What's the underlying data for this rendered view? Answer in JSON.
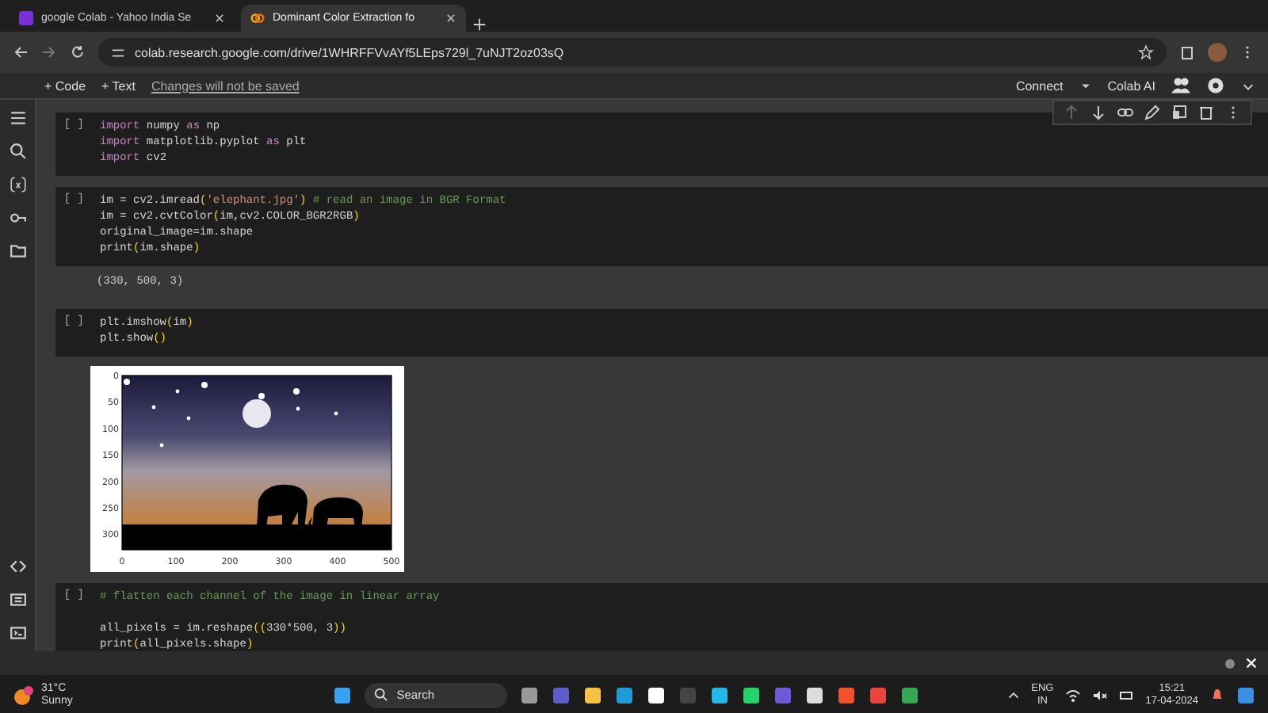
{
  "browser": {
    "tabs": [
      {
        "title": "google Colab - Yahoo India Se",
        "selected": false
      },
      {
        "title": "Dominant Color Extraction fo",
        "selected": true
      }
    ],
    "url": "colab.research.google.com/drive/1WHRFFVvAYf5LEps729l_7uNJT2oz03sQ"
  },
  "toolbar": {
    "add_code": "+ Code",
    "add_text": "+ Text",
    "notice": "Changes will not be saved",
    "connect": "Connect",
    "colab_ai": "Colab AI"
  },
  "cells": [
    {
      "run": "[ ]",
      "lines": [
        [
          {
            "kind": "kw",
            "text": "import"
          },
          {
            "kind": "plain",
            "text": " numpy "
          },
          {
            "kind": "kw",
            "text": "as"
          },
          {
            "kind": "plain",
            "text": " np"
          }
        ],
        [
          {
            "kind": "kw",
            "text": "import"
          },
          {
            "kind": "plain",
            "text": " matplotlib.pyplot "
          },
          {
            "kind": "kw",
            "text": "as"
          },
          {
            "kind": "plain",
            "text": " plt"
          }
        ],
        [
          {
            "kind": "kw",
            "text": "import"
          },
          {
            "kind": "plain",
            "text": " cv2"
          }
        ]
      ]
    },
    {
      "run": "[ ]",
      "lines": [
        [
          {
            "kind": "plain",
            "text": "im = cv2.imread"
          },
          {
            "kind": "br",
            "text": "("
          },
          {
            "kind": "str",
            "text": "'elephant.jpg'"
          },
          {
            "kind": "br",
            "text": ")"
          },
          {
            "kind": "cm",
            "text": " # read an image in BGR Format"
          }
        ],
        [
          {
            "kind": "plain",
            "text": "im = cv2.cvtColor"
          },
          {
            "kind": "br",
            "text": "("
          },
          {
            "kind": "plain",
            "text": "im,cv2.COLOR_BGR2RGB"
          },
          {
            "kind": "br",
            "text": ")"
          }
        ],
        [
          {
            "kind": "plain",
            "text": "original_image=im.shape"
          }
        ],
        [
          {
            "kind": "plain",
            "text": "print"
          },
          {
            "kind": "br",
            "text": "("
          },
          {
            "kind": "plain",
            "text": "im.shape"
          },
          {
            "kind": "br",
            "text": ")"
          }
        ]
      ],
      "output": {
        "kind": "text",
        "text": "(330, 500, 3)"
      }
    },
    {
      "run": "[ ]",
      "lines": [
        [
          {
            "kind": "plain",
            "text": "plt.imshow"
          },
          {
            "kind": "br",
            "text": "("
          },
          {
            "kind": "plain",
            "text": "im"
          },
          {
            "kind": "br",
            "text": ")"
          }
        ],
        [
          {
            "kind": "plain",
            "text": "plt.show"
          },
          {
            "kind": "br",
            "text": "()"
          }
        ]
      ],
      "output": {
        "kind": "plot",
        "xticks": [
          "0",
          "100",
          "200",
          "300",
          "400",
          "500"
        ],
        "yticks": [
          "0",
          "50",
          "100",
          "150",
          "200",
          "250",
          "300"
        ]
      }
    },
    {
      "run": "[ ]",
      "lines": [
        [
          {
            "kind": "cm",
            "text": "# flatten each channel of the image in linear array"
          }
        ],
        [
          {
            "kind": "plain",
            "text": "all_pixels = im.reshape"
          },
          {
            "kind": "br",
            "text": "(("
          },
          {
            "kind": "plain",
            "text": "330*500, 3"
          },
          {
            "kind": "br",
            "text": "))"
          }
        ],
        [
          {
            "kind": "plain",
            "text": "print"
          },
          {
            "kind": "br",
            "text": "("
          },
          {
            "kind": "plain",
            "text": "all_pixels.shape"
          },
          {
            "kind": "br",
            "text": ")"
          }
        ]
      ],
      "gap_after_first": true
    }
  ],
  "taskbar": {
    "temperature": "31°C",
    "weather": "Sunny",
    "search": "Search",
    "language": "ENG",
    "region": "IN",
    "time": "15:21",
    "date": "17-04-2024"
  }
}
